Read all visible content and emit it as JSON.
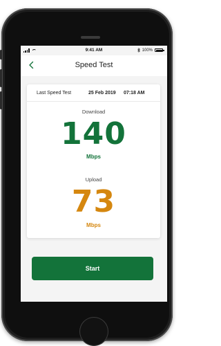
{
  "status_bar": {
    "time": "9:41 AM",
    "battery_text": "100%",
    "icons": [
      "signal-icon",
      "wifi-icon",
      "bluetooth-icon",
      "battery-icon"
    ]
  },
  "nav": {
    "title": "Speed Test",
    "back_icon": "chevron-left-icon"
  },
  "last_speed_test": {
    "label": "Last Speed Test",
    "date": "25 Feb 2019",
    "time": "07:18 AM"
  },
  "download": {
    "label": "Download",
    "value": "140",
    "unit": "Mbps",
    "color": "#13733a"
  },
  "upload": {
    "label": "Upload",
    "value": "73",
    "unit": "Mbps",
    "color": "#d5870f"
  },
  "start_button": {
    "label": "Start",
    "color": "#13733a"
  },
  "colors": {
    "accent": "#13733a",
    "screen_background": "#f4f4f4",
    "card_background": "#ffffff"
  }
}
